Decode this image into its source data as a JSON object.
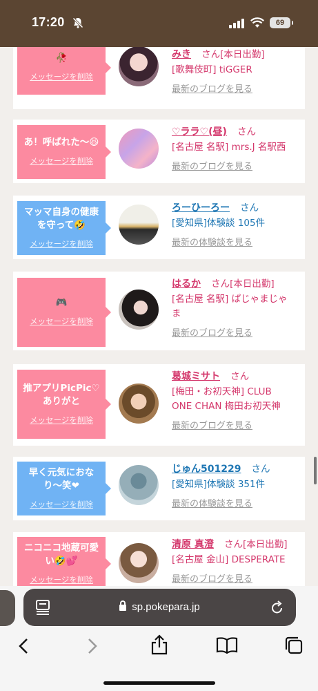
{
  "status": {
    "time": "17:20",
    "battery": "69"
  },
  "cards": [
    {
      "bubble": "🥀",
      "bubble_color": "pink",
      "delete": "メッセージを削除",
      "name": "みき",
      "honorific": "さん",
      "extra": "[本日出勤]",
      "lines": [
        "[歌舞伎町] tiGGER"
      ],
      "link": "最新のブログを見る",
      "type": "girl"
    },
    {
      "bubble": "あ！呼ばれた〜😆",
      "bubble_color": "pink",
      "delete": "メッセージを削除",
      "name": "♡ララ♡(昼)",
      "honorific": "さん",
      "extra": "",
      "lines": [
        "[名古屋 名駅] mrs.J 名駅西"
      ],
      "link": "最新のブログを見る",
      "type": "girl"
    },
    {
      "bubble": "マッマ自身の健康を守って🤣",
      "bubble_color": "blue",
      "delete": "メッセージを削除",
      "name": "ろーひーろー",
      "honorific": "さん",
      "extra": "",
      "lines": [
        "[愛知県]体験談 105件"
      ],
      "link": "最新の体験談を見る",
      "type": "user"
    },
    {
      "bubble": "🎮",
      "bubble_color": "pink",
      "delete": "メッセージを削除",
      "name": "はるか",
      "honorific": "さん",
      "extra": "[本日出勤]",
      "lines": [
        "[名古屋 名駅] ぱじゃまじゃ",
        "ま"
      ],
      "link": "最新のブログを見る",
      "type": "girl"
    },
    {
      "bubble": "推アプリPicPic♡ありがと",
      "bubble_color": "pink",
      "delete": "メッセージを削除",
      "name": "葛城ミサト",
      "honorific": "さん",
      "extra": "",
      "lines": [
        "[梅田・お初天神] CLUB",
        "ONE CHAN 梅田お初天神"
      ],
      "link": "最新のブログを見る",
      "type": "girl"
    },
    {
      "bubble": "早く元気におなり〜笑❤",
      "bubble_color": "blue",
      "delete": "メッセージを削除",
      "name": "じゅん501229",
      "honorific": "さん",
      "extra": "",
      "lines": [
        "[愛知県]体験談 351件"
      ],
      "link": "最新の体験談を見る",
      "type": "user"
    },
    {
      "bubble": "ニコニコ地蔵可愛い🤣💕",
      "bubble_color": "pink",
      "delete": "メッセージを削除",
      "name": "清原 真澄",
      "honorific": "さん",
      "extra": "[本日出勤]",
      "lines": [
        "[名古屋 金山] DESPERATE"
      ],
      "link": "最新のブログを見る",
      "type": "girl"
    }
  ],
  "browser": {
    "url": "sp.pokepara.jp"
  },
  "colors": {
    "status_bg": "#5b4532",
    "pink": "#fc8aa0",
    "blue": "#70b3f4",
    "name_pink": "#d4386c",
    "name_blue": "#1f77b4"
  }
}
